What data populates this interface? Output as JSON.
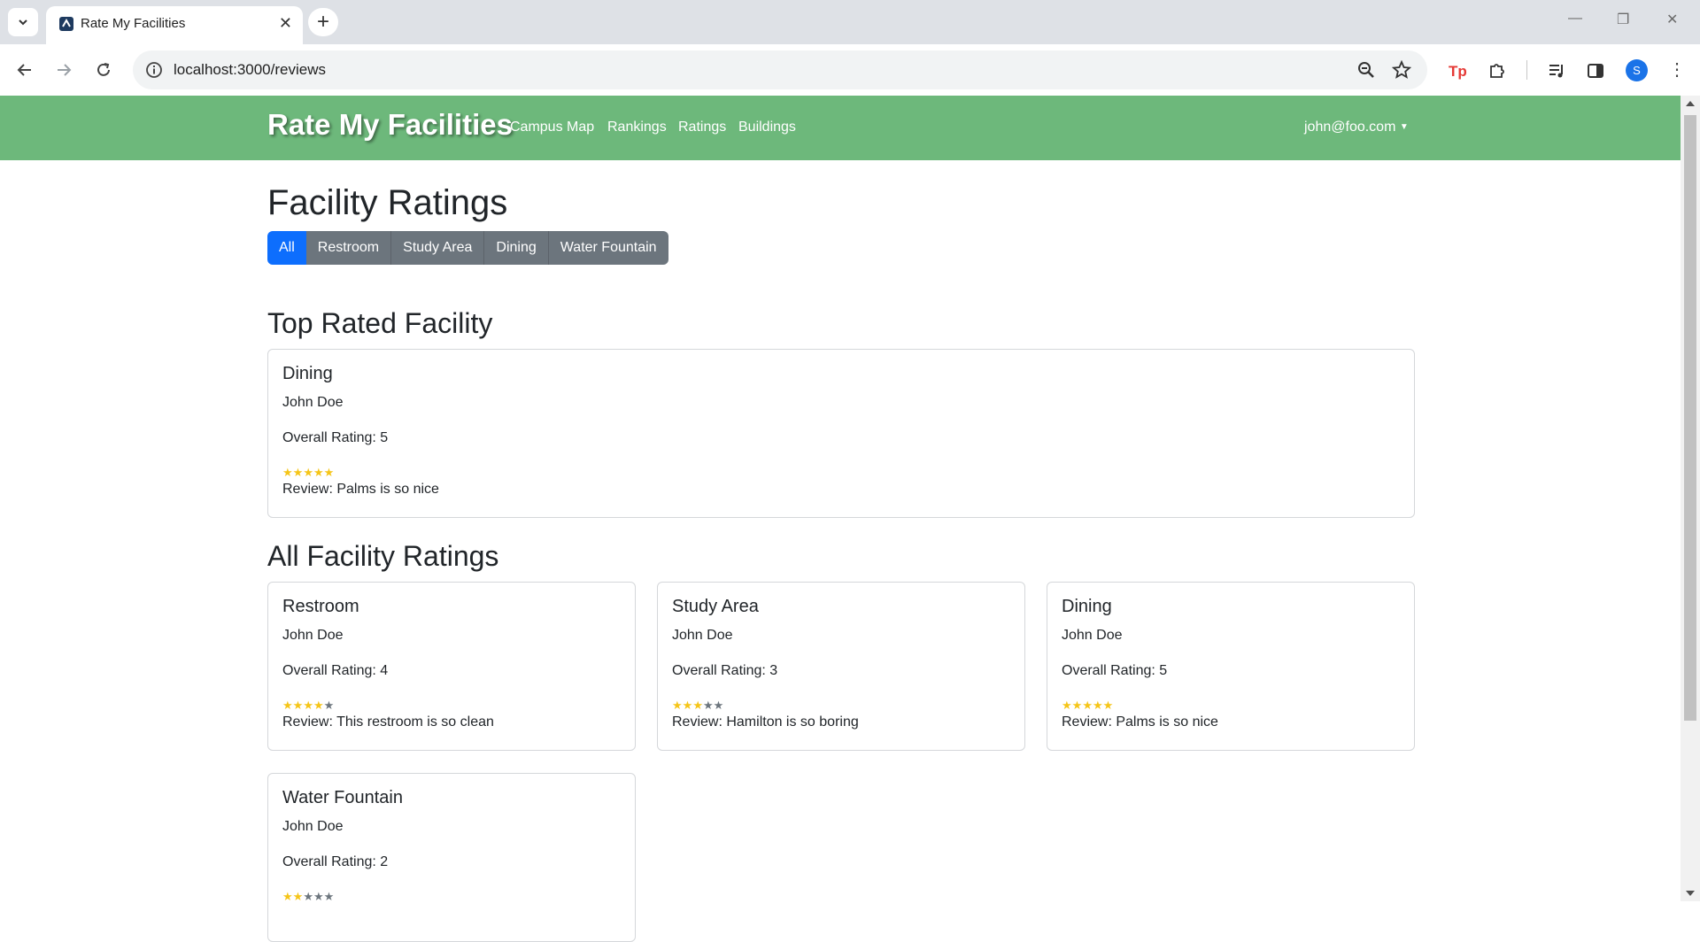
{
  "browser": {
    "tab_title": "Rate My Facilities",
    "url": "localhost:3000/reviews",
    "profile_initial": "S"
  },
  "navbar": {
    "brand": "Rate My Facilities",
    "links": [
      "Campus Map",
      "Rankings",
      "Ratings",
      "Buildings"
    ],
    "user": "john@foo.com"
  },
  "page": {
    "title": "Facility Ratings",
    "filters": [
      "All",
      "Restroom",
      "Study Area",
      "Dining",
      "Water Fountain"
    ],
    "active_filter": "All",
    "top_heading": "Top Rated Facility",
    "all_heading": "All Facility Ratings"
  },
  "top_rated": {
    "facility": "Dining",
    "author": "John Doe",
    "rating_text": "Overall Rating: 5",
    "stars": 5,
    "review": "Review: Palms is so nice"
  },
  "ratings": [
    {
      "facility": "Restroom",
      "author": "John Doe",
      "rating_text": "Overall Rating: 4",
      "stars": 4,
      "review": "Review: This restroom is so clean"
    },
    {
      "facility": "Study Area",
      "author": "John Doe",
      "rating_text": "Overall Rating: 3",
      "stars": 3,
      "review": "Review: Hamilton is so boring"
    },
    {
      "facility": "Dining",
      "author": "John Doe",
      "rating_text": "Overall Rating: 5",
      "stars": 5,
      "review": "Review: Palms is so nice"
    },
    {
      "facility": "Water Fountain",
      "author": "John Doe",
      "rating_text": "Overall Rating: 2",
      "stars": 2,
      "review": ""
    }
  ],
  "colors": {
    "navbar": "#6db87b",
    "active_filter": "#0d6efd",
    "filter": "#6c757d",
    "star_on": "#f5c518",
    "star_off": "#6c757d"
  }
}
